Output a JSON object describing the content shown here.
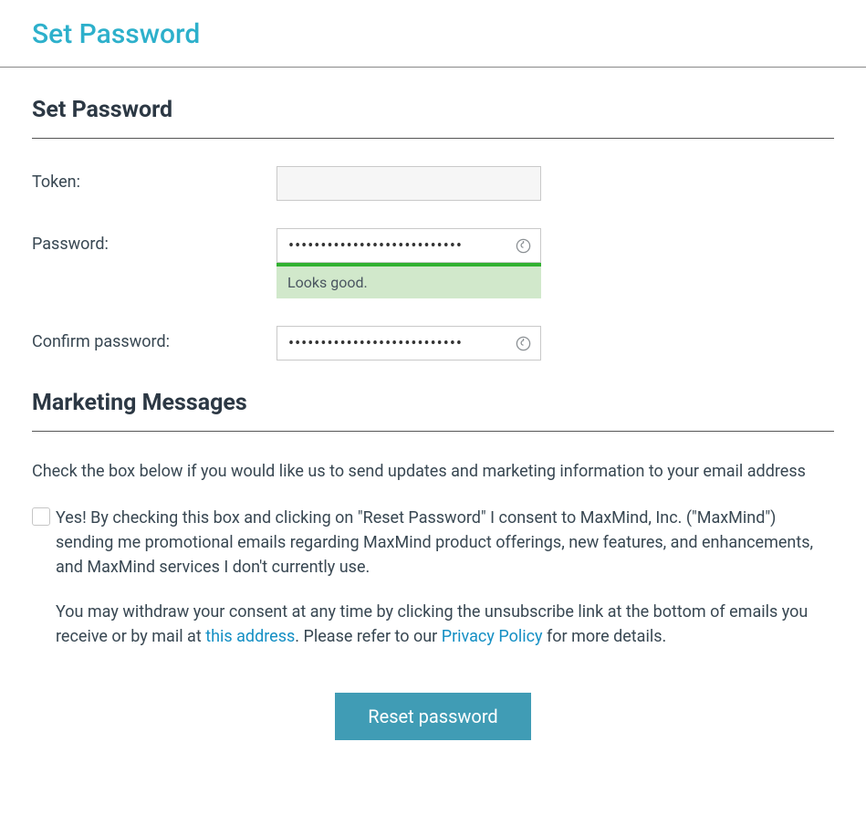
{
  "header": {
    "title": "Set Password"
  },
  "form": {
    "section_title": "Set Password",
    "token": {
      "label": "Token:",
      "value": ""
    },
    "password": {
      "label": "Password:",
      "value": "•••••••••••••••••••••••••••",
      "strength_message": "Looks good."
    },
    "confirm_password": {
      "label": "Confirm password:",
      "value": "•••••••••••••••••••••••••••"
    }
  },
  "marketing": {
    "section_title": "Marketing Messages",
    "intro": "Check the box below if you would like us to send updates and marketing information to your email address",
    "consent_para1": "Yes! By checking this box and clicking on \"Reset Password\" I consent to MaxMind, Inc. (\"MaxMind\") sending me promotional emails regarding MaxMind product offerings, new features, and enhancements, and MaxMind services I don't currently use.",
    "consent_para2_prefix": "You may withdraw your consent at any time by clicking the unsubscribe link at the bottom of emails you receive or by mail at ",
    "consent_para2_link1": "this address",
    "consent_para2_mid": ". Please refer to our ",
    "consent_para2_link2": "Privacy Policy",
    "consent_para2_suffix": " for more details."
  },
  "actions": {
    "reset_button": "Reset password"
  }
}
